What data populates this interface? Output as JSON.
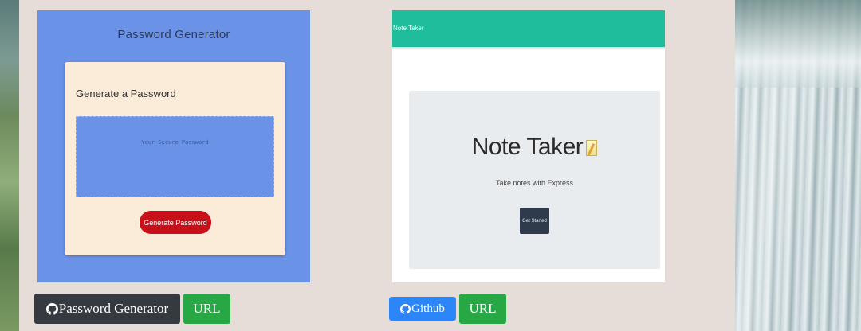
{
  "colors": {
    "panel": "#e6dcd8",
    "password_thumb_bg": "#6a93e8",
    "password_card_bg": "#fbebd9",
    "password_btn": "#c8101a",
    "note_navbar": "#1fbd9c",
    "note_jumbotron": "#e9ecef",
    "btn_dark": "#343a40",
    "btn_green": "#28a745",
    "btn_blue": "#2d86f7"
  },
  "projects": [
    {
      "screenshot": {
        "title": "Password Generator",
        "card_heading": "Generate a Password",
        "textarea_placeholder": "Your Secure Password",
        "button_label": "Generate Password"
      },
      "repo_button": {
        "icon": "github-icon",
        "label": "Password Generator"
      },
      "url_button": {
        "label": "URL"
      }
    },
    {
      "screenshot": {
        "navbar_brand": "Note Taker",
        "heading": "Note Taker",
        "heading_icon": "memo-icon",
        "subtitle": "Take notes with Express",
        "button_label": "Get Started"
      },
      "repo_button": {
        "icon": "github-icon",
        "label": "Github"
      },
      "url_button": {
        "label": "URL"
      }
    }
  ]
}
